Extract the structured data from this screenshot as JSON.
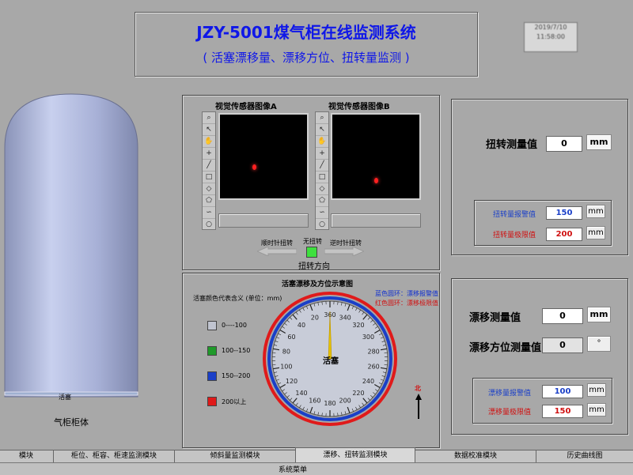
{
  "header": {
    "title": "JZY-5001煤气柜在线监测系统",
    "subtitle": "( 活塞漂移量、漂移方位、扭转量监测 )"
  },
  "tank": {
    "piston_label": "活塞",
    "label": "气柜柜体"
  },
  "cameras": {
    "a_label": "视觉传感器图像A",
    "b_label": "视觉传感器图像B"
  },
  "rotation_indicator": {
    "ccw": "顺时针扭转",
    "none": "无扭转",
    "cw": "逆时针扭转",
    "direction": "扭转方向",
    "led_color": "#3ee03e"
  },
  "diagram": {
    "title": "活塞漂移及方位示意图",
    "legend_title": "活塞颜色代表含义 (单位：mm)",
    "ring_blue": "蓝色圆环：漂移报警值",
    "ring_red": "红色圆环：漂移极限值",
    "center_label": "活塞",
    "north": "北",
    "needle_deg": 0,
    "ticks": [
      "360",
      "340",
      "320",
      "300",
      "280",
      "260",
      "240",
      "220",
      "200",
      "180",
      "160",
      "140",
      "120",
      "100",
      "80",
      "60",
      "40",
      "20"
    ],
    "legend": [
      {
        "label": "0----100",
        "color": "#c0c4d0"
      },
      {
        "label": "100--150",
        "color": "#1f9a2a"
      },
      {
        "label": "150--200",
        "color": "#1a3fc8"
      },
      {
        "label": "200以上",
        "color": "#e01a1a"
      }
    ]
  },
  "rotation": {
    "measured_label": "扭转测量值",
    "measured_value": "0",
    "unit": "mm",
    "alarm_label": "扭转量报警值",
    "alarm_value": "150",
    "limit_label": "扭转量极限值",
    "limit_value": "200"
  },
  "drift": {
    "measured_label": "漂移测量值",
    "measured_value": "0",
    "unit": "mm",
    "direction_label": "漂移方位测量值",
    "direction_value": "0",
    "direction_unit": "°",
    "alarm_label": "漂移量报警值",
    "alarm_value": "100",
    "limit_label": "漂移量极限值",
    "limit_value": "150"
  },
  "tabs": [
    "模块",
    "柜位、柜容、柜速监测模块",
    "倾斜量监测模块",
    "漂移、扭转监测模块",
    "数据校准模块",
    "历史曲线图"
  ],
  "bottom_menu": "系统菜单",
  "datetime": {
    "line1": "2019/7/10",
    "line2": "11:58:00"
  }
}
